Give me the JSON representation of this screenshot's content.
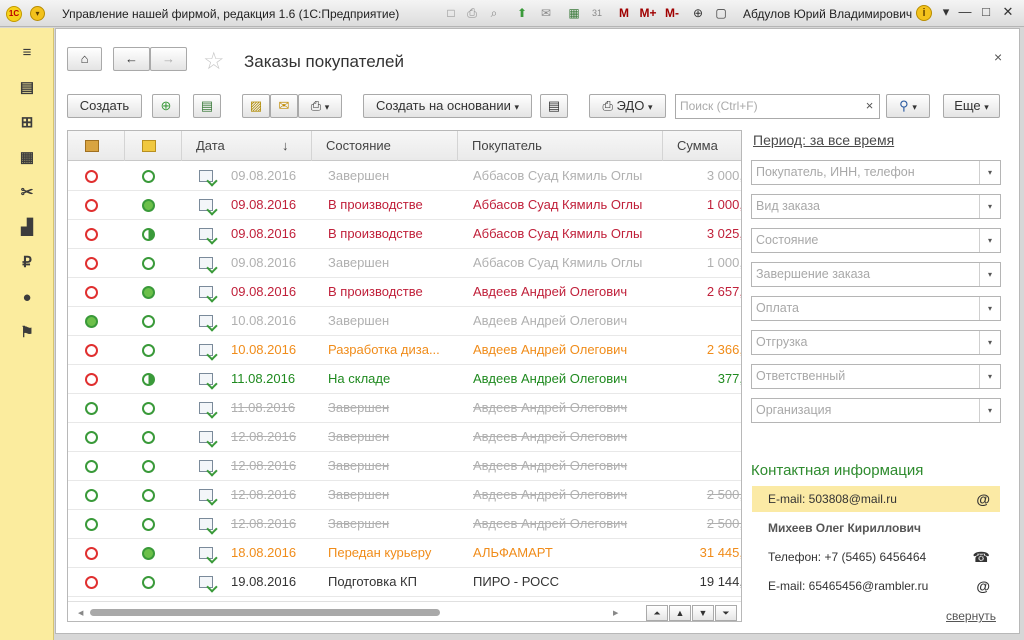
{
  "titlebar": {
    "app_title": "Управление нашей фирмой, редакция 1.6  (1С:Предприятие)",
    "logo": "1С",
    "menu_icon": "▾",
    "icons": [
      "□",
      "⎙",
      "⌕",
      "⬆",
      "✉",
      "▦",
      "31",
      "M",
      "M+",
      "M-",
      "⊕",
      "▢"
    ],
    "user": "Абдулов Юрий Владимирович",
    "info_icon": "i",
    "controls": [
      "▾",
      "—",
      "□",
      "✕"
    ]
  },
  "sidebar": {
    "items": [
      {
        "name": "menu",
        "glyph": "≡"
      },
      {
        "name": "desk",
        "glyph": "▤"
      },
      {
        "name": "basket",
        "glyph": "⊞"
      },
      {
        "name": "purchases",
        "glyph": "▦"
      },
      {
        "name": "service",
        "glyph": "✂"
      },
      {
        "name": "production",
        "glyph": "▟"
      },
      {
        "name": "finance",
        "glyph": "₽"
      },
      {
        "name": "people",
        "glyph": "●"
      },
      {
        "name": "flag",
        "glyph": "⚑"
      }
    ]
  },
  "header": {
    "home_icon": "⌂",
    "back_icon": "←",
    "forward_icon": "→",
    "star_icon": "☆",
    "title": "Заказы покупателей",
    "close_icon": "×"
  },
  "toolbar": {
    "create": "Создать",
    "create_copy_icon": "⊕",
    "report_icon": "▤",
    "docs_icon": "▨",
    "mail_icon": "✉",
    "print_icon": "⎙",
    "print_arrow": "▾",
    "create_based": "Создать на основании",
    "create_based_arrow": "▾",
    "list_icon": "▤",
    "edo_icon": "⎙",
    "edo": "ЭДО",
    "edo_arrow": "▾",
    "search_placeholder": "Поиск (Ctrl+F)",
    "search_clear": "×",
    "search_icon": "⚲",
    "search_arrow": "▾",
    "more": "Еще",
    "more_arrow": "▾"
  },
  "grid": {
    "headers": {
      "c1": "",
      "c2": "",
      "date": "Дата",
      "sort": "↓",
      "state": "Состояние",
      "buyer": "Покупатель",
      "sum": "Сумма"
    },
    "rows": [
      {
        "d1": "#e03030",
        "d1fill": "#fff",
        "d2": "#3a9a3a",
        "d2fill": "#fff",
        "date": "09.08.2016",
        "state": "Завершен",
        "buyer": "Аббасов Суад Кямиль Оглы",
        "sum": "3 000,",
        "color": "#b0b0b0",
        "strike": false
      },
      {
        "d1": "#e03030",
        "d1fill": "#fff",
        "d2": "#3a9a3a",
        "d2fill": "#6cc04a",
        "date": "09.08.2016",
        "state": "В производстве",
        "buyer": "Аббасов Суад Кямиль Оглы",
        "sum": "1 000,",
        "color": "#c0203a",
        "strike": false
      },
      {
        "d1": "#e03030",
        "d1fill": "#fff",
        "d2": "#3a9a3a",
        "d2fill": "half",
        "date": "09.08.2016",
        "state": "В производстве",
        "buyer": "Аббасов Суад Кямиль Оглы",
        "sum": "3 025,",
        "color": "#c0203a",
        "strike": false
      },
      {
        "d1": "#e03030",
        "d1fill": "#fff",
        "d2": "#3a9a3a",
        "d2fill": "#fff",
        "date": "09.08.2016",
        "state": "Завершен",
        "buyer": "Аббасов Суад Кямиль Оглы",
        "sum": "1 000,",
        "color": "#b0b0b0",
        "strike": false
      },
      {
        "d1": "#e03030",
        "d1fill": "#fff",
        "d2": "#3a9a3a",
        "d2fill": "#6cc04a",
        "date": "09.08.2016",
        "state": "В производстве",
        "buyer": "Авдеев Андрей Олегович",
        "sum": "2 657,",
        "color": "#c0203a",
        "strike": false
      },
      {
        "d1": "#3a9a3a",
        "d1fill": "#6cc04a",
        "d2": "#3a9a3a",
        "d2fill": "#fff",
        "date": "10.08.2016",
        "state": "Завершен",
        "buyer": "Авдеев Андрей Олегович",
        "sum": "",
        "color": "#b0b0b0",
        "strike": false
      },
      {
        "d1": "#e03030",
        "d1fill": "#fff",
        "d2": "#3a9a3a",
        "d2fill": "#fff",
        "date": "10.08.2016",
        "state": "Разработка диза...",
        "buyer": "Авдеев Андрей Олегович",
        "sum": "2 366,",
        "color": "#f08c1a",
        "strike": false
      },
      {
        "d1": "#e03030",
        "d1fill": "#fff",
        "d2": "#3a9a3a",
        "d2fill": "half",
        "date": "11.08.2016",
        "state": "На складе",
        "buyer": "Авдеев Андрей Олегович",
        "sum": "377,",
        "color": "#1f8a1f",
        "strike": false
      },
      {
        "d1": "#3a9a3a",
        "d1fill": "#fff",
        "d2": "#3a9a3a",
        "d2fill": "#fff",
        "date": "11.08.2016",
        "state": "Завершен",
        "buyer": "Авдеев Андрей Олегович",
        "sum": "",
        "color": "#b0b0b0",
        "strike": true
      },
      {
        "d1": "#3a9a3a",
        "d1fill": "#fff",
        "d2": "#3a9a3a",
        "d2fill": "#fff",
        "date": "12.08.2016",
        "state": "Завершен",
        "buyer": "Авдеев Андрей Олегович",
        "sum": "",
        "color": "#b0b0b0",
        "strike": true
      },
      {
        "d1": "#3a9a3a",
        "d1fill": "#fff",
        "d2": "#3a9a3a",
        "d2fill": "#fff",
        "date": "12.08.2016",
        "state": "Завершен",
        "buyer": "Авдеев Андрей Олегович",
        "sum": "",
        "color": "#b0b0b0",
        "strike": true
      },
      {
        "d1": "#3a9a3a",
        "d1fill": "#fff",
        "d2": "#3a9a3a",
        "d2fill": "#fff",
        "date": "12.08.2016",
        "state": "Завершен",
        "buyer": "Авдеев Андрей Олегович",
        "sum": "2 500,",
        "color": "#b0b0b0",
        "strike": true
      },
      {
        "d1": "#3a9a3a",
        "d1fill": "#fff",
        "d2": "#3a9a3a",
        "d2fill": "#fff",
        "date": "12.08.2016",
        "state": "Завершен",
        "buyer": "Авдеев Андрей Олегович",
        "sum": "2 500,",
        "color": "#b0b0b0",
        "strike": true
      },
      {
        "d1": "#e03030",
        "d1fill": "#fff",
        "d2": "#3a9a3a",
        "d2fill": "#6cc04a",
        "date": "18.08.2016",
        "state": "Передан курьеру",
        "buyer": "АЛЬФАМАРТ",
        "sum": "31 445,",
        "color": "#f08c1a",
        "strike": false
      },
      {
        "d1": "#e03030",
        "d1fill": "#fff",
        "d2": "#3a9a3a",
        "d2fill": "#fff",
        "date": "19.08.2016",
        "state": "Подготовка КП",
        "buyer": "ПИРО - РОСС",
        "sum": "19 144,",
        "color": "#333333",
        "strike": false
      }
    ],
    "nav": [
      "⏶",
      "▲",
      "▼",
      "⏷"
    ]
  },
  "filters": {
    "period": "Период: за все время",
    "selects": [
      "Покупатель, ИНН, телефон",
      "Вид заказа",
      "Состояние",
      "Завершение заказа",
      "Оплата",
      "Отгрузка",
      "Ответственный",
      "Организация"
    ],
    "arrow": "▾"
  },
  "contacts": {
    "title": "Контактная информация",
    "email1": "E-mail: 503808@mail.ru",
    "email1_icon": "@",
    "person": "Михеев Олег Кириллович",
    "phone": "Телефон: +7 (5465) 6456464",
    "phone_icon": "☎",
    "email2": "E-mail: 65465456@rambler.ru",
    "email2_icon": "@",
    "collapse": "свернуть"
  }
}
